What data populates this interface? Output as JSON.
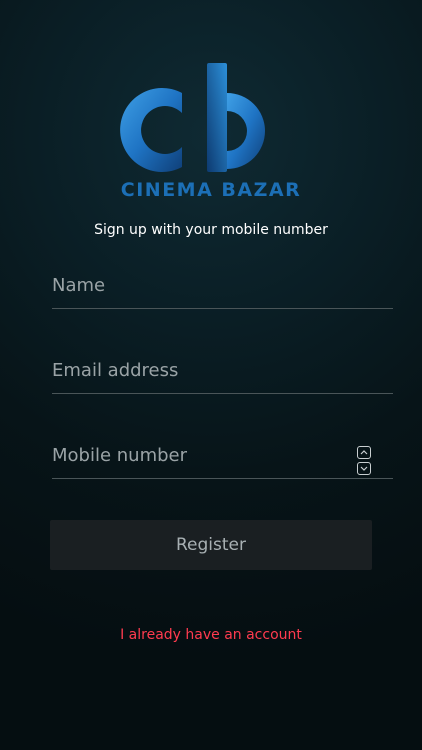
{
  "brand": {
    "name": "CINEMA BAZAR",
    "accent_color": "#1c6fb6"
  },
  "subtitle": "Sign up with your mobile number",
  "form": {
    "name": {
      "placeholder": "Name",
      "value": ""
    },
    "email": {
      "placeholder": "Email address",
      "value": ""
    },
    "mobile": {
      "placeholder": "Mobile number",
      "value": ""
    },
    "register_label": "Register"
  },
  "login_link": "I already have an account",
  "colors": {
    "link": "#ff3b4f",
    "button_bg": "#1a1f22"
  }
}
